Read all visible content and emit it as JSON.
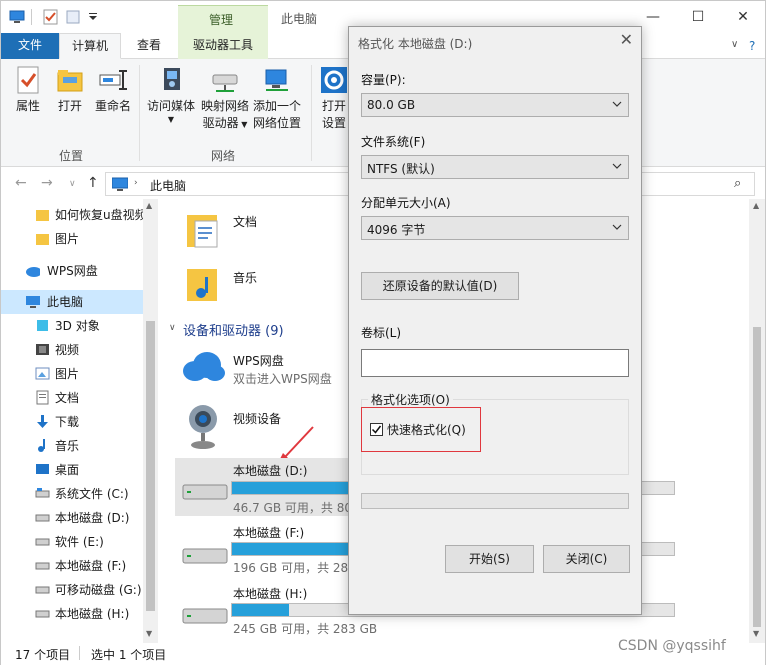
{
  "window": {
    "title": "此电脑",
    "context_tab": "管理",
    "tabs": {
      "file": "文件",
      "computer": "计算机",
      "view": "查看",
      "drive_tools": "驱动器工具"
    },
    "controls": {
      "minimize": "—",
      "maximize": "☐",
      "close": "✕"
    }
  },
  "ribbon": {
    "location": {
      "label": "位置",
      "buttons": {
        "properties": "属性",
        "open": "打开",
        "rename": "重命名"
      }
    },
    "network": {
      "label": "网络",
      "buttons": {
        "media_1": "访问媒体",
        "map_1": "映射网络",
        "map_2": "驱动器",
        "add_1": "添加一个",
        "add_2": "网络位置"
      }
    },
    "system": {
      "open_1": "打开",
      "open_2": "设置"
    }
  },
  "address": {
    "path": "此电脑"
  },
  "sidebar": {
    "items": [
      {
        "label": "如何恢复u盘视频",
        "icon": "folder-icon"
      },
      {
        "label": "图片",
        "icon": "folder-icon"
      },
      {
        "label": "WPS网盘",
        "icon": "cloud-icon"
      },
      {
        "label": "此电脑",
        "icon": "computer-icon"
      },
      {
        "label": "3D 对象",
        "icon": "cube-icon"
      },
      {
        "label": "视频",
        "icon": "film-icon"
      },
      {
        "label": "图片",
        "icon": "picture-icon"
      },
      {
        "label": "文档",
        "icon": "document-icon"
      },
      {
        "label": "下载",
        "icon": "download-icon"
      },
      {
        "label": "音乐",
        "icon": "music-icon"
      },
      {
        "label": "桌面",
        "icon": "desktop-icon"
      },
      {
        "label": "系统文件 (C:)",
        "icon": "drive-icon"
      },
      {
        "label": "本地磁盘 (D:)",
        "icon": "drive-icon"
      },
      {
        "label": "软件 (E:)",
        "icon": "drive-icon"
      },
      {
        "label": "本地磁盘 (F:)",
        "icon": "drive-icon"
      },
      {
        "label": "可移动磁盘 (G:)",
        "icon": "drive-icon"
      },
      {
        "label": "本地磁盘 (H:)",
        "icon": "drive-icon"
      }
    ]
  },
  "content": {
    "folders": {
      "documents": "文档",
      "music": "音乐"
    },
    "section_header": "设备和驱动器 (9)",
    "wps": {
      "name": "WPS网盘",
      "sub": "双击进入WPS网盘"
    },
    "camera": {
      "name": "视频设备"
    },
    "drives": [
      {
        "name": "本地磁盘 (D:)",
        "sub": "46.7 GB 可用，共 80",
        "used_fraction": 0.42
      },
      {
        "name": "本地磁盘 (F:)",
        "sub": "196 GB 可用，共 284",
        "used_fraction": 0.31
      },
      {
        "name": "本地磁盘 (H:)",
        "sub": "245 GB 可用，共 283 GB",
        "used_fraction": 0.13
      }
    ]
  },
  "status": {
    "count": "17 个项目",
    "selected": "选中 1 个项目"
  },
  "dialog": {
    "title": "格式化 本地磁盘 (D:)",
    "capacity_label": "容量(P):",
    "capacity_value": "80.0 GB",
    "fs_label": "文件系统(F)",
    "fs_value": "NTFS (默认)",
    "alloc_label": "分配单元大小(A)",
    "alloc_value": "4096 字节",
    "restore_button": "还原设备的默认值(D)",
    "volume_label": "卷标(L)",
    "volume_value": "",
    "options_label": "格式化选项(O)",
    "quick_format": "快速格式化(Q)",
    "quick_format_checked": true,
    "start_button": "开始(S)",
    "close_button": "关闭(C)"
  },
  "watermark": "CSDN @yqssihf",
  "colors": {
    "accent": "#1e6fb6",
    "drive_fill": "#26a0da",
    "highlight": "#e0383e"
  }
}
